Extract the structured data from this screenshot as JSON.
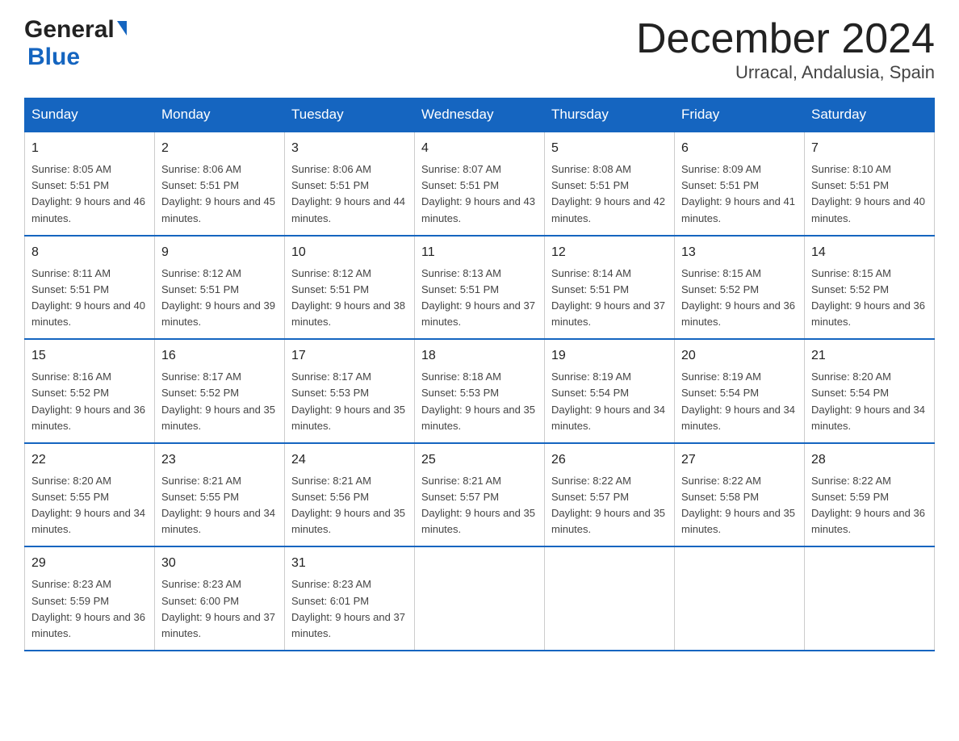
{
  "logo": {
    "general": "General",
    "blue": "Blue",
    "triangle": "▲"
  },
  "title": {
    "month": "December 2024",
    "location": "Urracal, Andalusia, Spain"
  },
  "headers": [
    "Sunday",
    "Monday",
    "Tuesday",
    "Wednesday",
    "Thursday",
    "Friday",
    "Saturday"
  ],
  "weeks": [
    [
      {
        "day": "1",
        "sunrise": "8:05 AM",
        "sunset": "5:51 PM",
        "daylight": "9 hours and 46 minutes."
      },
      {
        "day": "2",
        "sunrise": "8:06 AM",
        "sunset": "5:51 PM",
        "daylight": "9 hours and 45 minutes."
      },
      {
        "day": "3",
        "sunrise": "8:06 AM",
        "sunset": "5:51 PM",
        "daylight": "9 hours and 44 minutes."
      },
      {
        "day": "4",
        "sunrise": "8:07 AM",
        "sunset": "5:51 PM",
        "daylight": "9 hours and 43 minutes."
      },
      {
        "day": "5",
        "sunrise": "8:08 AM",
        "sunset": "5:51 PM",
        "daylight": "9 hours and 42 minutes."
      },
      {
        "day": "6",
        "sunrise": "8:09 AM",
        "sunset": "5:51 PM",
        "daylight": "9 hours and 41 minutes."
      },
      {
        "day": "7",
        "sunrise": "8:10 AM",
        "sunset": "5:51 PM",
        "daylight": "9 hours and 40 minutes."
      }
    ],
    [
      {
        "day": "8",
        "sunrise": "8:11 AM",
        "sunset": "5:51 PM",
        "daylight": "9 hours and 40 minutes."
      },
      {
        "day": "9",
        "sunrise": "8:12 AM",
        "sunset": "5:51 PM",
        "daylight": "9 hours and 39 minutes."
      },
      {
        "day": "10",
        "sunrise": "8:12 AM",
        "sunset": "5:51 PM",
        "daylight": "9 hours and 38 minutes."
      },
      {
        "day": "11",
        "sunrise": "8:13 AM",
        "sunset": "5:51 PM",
        "daylight": "9 hours and 37 minutes."
      },
      {
        "day": "12",
        "sunrise": "8:14 AM",
        "sunset": "5:51 PM",
        "daylight": "9 hours and 37 minutes."
      },
      {
        "day": "13",
        "sunrise": "8:15 AM",
        "sunset": "5:52 PM",
        "daylight": "9 hours and 36 minutes."
      },
      {
        "day": "14",
        "sunrise": "8:15 AM",
        "sunset": "5:52 PM",
        "daylight": "9 hours and 36 minutes."
      }
    ],
    [
      {
        "day": "15",
        "sunrise": "8:16 AM",
        "sunset": "5:52 PM",
        "daylight": "9 hours and 36 minutes."
      },
      {
        "day": "16",
        "sunrise": "8:17 AM",
        "sunset": "5:52 PM",
        "daylight": "9 hours and 35 minutes."
      },
      {
        "day": "17",
        "sunrise": "8:17 AM",
        "sunset": "5:53 PM",
        "daylight": "9 hours and 35 minutes."
      },
      {
        "day": "18",
        "sunrise": "8:18 AM",
        "sunset": "5:53 PM",
        "daylight": "9 hours and 35 minutes."
      },
      {
        "day": "19",
        "sunrise": "8:19 AM",
        "sunset": "5:54 PM",
        "daylight": "9 hours and 34 minutes."
      },
      {
        "day": "20",
        "sunrise": "8:19 AM",
        "sunset": "5:54 PM",
        "daylight": "9 hours and 34 minutes."
      },
      {
        "day": "21",
        "sunrise": "8:20 AM",
        "sunset": "5:54 PM",
        "daylight": "9 hours and 34 minutes."
      }
    ],
    [
      {
        "day": "22",
        "sunrise": "8:20 AM",
        "sunset": "5:55 PM",
        "daylight": "9 hours and 34 minutes."
      },
      {
        "day": "23",
        "sunrise": "8:21 AM",
        "sunset": "5:55 PM",
        "daylight": "9 hours and 34 minutes."
      },
      {
        "day": "24",
        "sunrise": "8:21 AM",
        "sunset": "5:56 PM",
        "daylight": "9 hours and 35 minutes."
      },
      {
        "day": "25",
        "sunrise": "8:21 AM",
        "sunset": "5:57 PM",
        "daylight": "9 hours and 35 minutes."
      },
      {
        "day": "26",
        "sunrise": "8:22 AM",
        "sunset": "5:57 PM",
        "daylight": "9 hours and 35 minutes."
      },
      {
        "day": "27",
        "sunrise": "8:22 AM",
        "sunset": "5:58 PM",
        "daylight": "9 hours and 35 minutes."
      },
      {
        "day": "28",
        "sunrise": "8:22 AM",
        "sunset": "5:59 PM",
        "daylight": "9 hours and 36 minutes."
      }
    ],
    [
      {
        "day": "29",
        "sunrise": "8:23 AM",
        "sunset": "5:59 PM",
        "daylight": "9 hours and 36 minutes."
      },
      {
        "day": "30",
        "sunrise": "8:23 AM",
        "sunset": "6:00 PM",
        "daylight": "9 hours and 37 minutes."
      },
      {
        "day": "31",
        "sunrise": "8:23 AM",
        "sunset": "6:01 PM",
        "daylight": "9 hours and 37 minutes."
      },
      null,
      null,
      null,
      null
    ]
  ]
}
